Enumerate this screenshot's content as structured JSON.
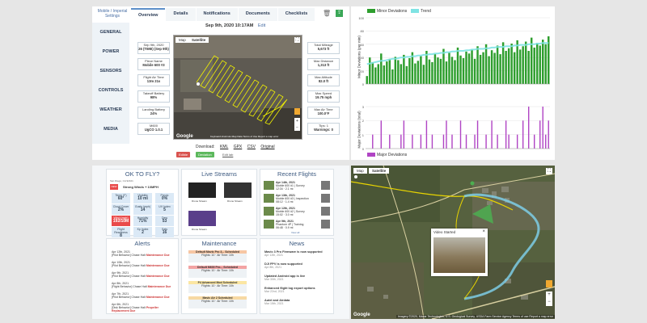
{
  "details": {
    "breadcrumb": "Mobile / Imperial Settings",
    "tabs": [
      "Overview",
      "Details",
      "Notifications",
      "Documents",
      "Checklists"
    ],
    "side_nav": [
      "GENERAL",
      "POWER",
      "SENSORS",
      "CONTROLS",
      "WEATHER",
      "MEDIA"
    ],
    "date_header": "Sep 9th, 2020 10:17AM",
    "edit_label": "Edit",
    "info_left": [
      {
        "label": "Sep 9th, 2020",
        "value": "26 (TIME) (Sep 9th)"
      },
      {
        "label": "Piece Name",
        "value": "Mobile 600 #3"
      },
      {
        "label": "Flight Air Time",
        "value": "13m 21s"
      },
      {
        "label": "Takeoff Battery",
        "value": "98%"
      },
      {
        "label": "Landing Battery",
        "value": "24%"
      },
      {
        "label": "M600",
        "value": "UgCO 1.0.1"
      }
    ],
    "info_right": [
      {
        "label": "Total Mileage",
        "value": "5,673 ft"
      },
      {
        "label": "Max Distance",
        "value": "1,313 ft"
      },
      {
        "label": "Max Altitude",
        "value": "82.0 ft"
      },
      {
        "label": "Max Speed",
        "value": "19.75 mph"
      },
      {
        "label": "Max Air Time",
        "value": "100.0°F"
      },
      {
        "label": "Tips: 1",
        "value": "Warnings: 0"
      }
    ],
    "map_tabs": [
      "Map",
      "Satellite"
    ],
    "map_footer": "Keyboard shortcuts   Map Data   Terms of Use   Report a map error",
    "download_label": "Download:",
    "download_links": [
      "KML",
      "GPX",
      "CSV",
      "Original"
    ],
    "badges": [
      {
        "label": "Edible",
        "color": "#d9534f"
      },
      {
        "label": "Deviation",
        "color": "#5cb85c"
      }
    ],
    "delete_label": "Edit lab"
  },
  "charts": {
    "legend_top": [
      {
        "label": "Minor Deviations",
        "color": "#2e9e2e"
      },
      {
        "label": "Trend",
        "color": "#7fe3e3"
      }
    ],
    "legend_bottom": [
      {
        "label": "Major Deviations",
        "color": "#b044c4"
      }
    ],
    "ylabel_top": "Minor Deviations (per min)",
    "ylabel_bottom": "Major Deviations (total)",
    "yticks_top": [
      "100",
      "80",
      "60",
      "40",
      "20",
      "0"
    ],
    "yticks_bottom": [
      "3",
      "2",
      "1",
      "0"
    ]
  },
  "chart_data": [
    {
      "type": "bar",
      "title": "",
      "ylabel": "Minor Deviations (per min)",
      "ylim": [
        0,
        100
      ],
      "series": [
        {
          "name": "Minor Deviations",
          "values": [
            12,
            40,
            33,
            25,
            30,
            46,
            28,
            34,
            38,
            22,
            41,
            36,
            30,
            44,
            27,
            39,
            48,
            31,
            35,
            42,
            29,
            50,
            37,
            33,
            45,
            40,
            38,
            53,
            34,
            47,
            41,
            36,
            55,
            43,
            39,
            49,
            46,
            52,
            38,
            57,
            44,
            48,
            60,
            42,
            51,
            47,
            58,
            45,
            63,
            50,
            54,
            61,
            48,
            66,
            52,
            57,
            64,
            50,
            70,
            55,
            62,
            58,
            67,
            60,
            72
          ]
        },
        {
          "name": "Trend",
          "values": [
            30,
            31,
            32,
            33,
            34,
            35,
            35,
            36,
            37,
            38,
            38,
            39,
            40,
            40,
            41,
            41,
            42,
            42,
            43,
            43,
            44,
            44,
            45,
            45,
            46,
            46,
            47,
            47,
            48,
            48,
            49,
            49,
            50,
            50,
            50,
            51,
            51,
            52,
            52,
            53,
            53,
            53,
            54,
            54,
            55,
            55,
            56,
            56,
            56,
            57,
            57,
            57,
            58,
            58,
            59,
            59,
            59,
            60,
            60,
            60,
            61,
            61,
            62,
            62,
            62
          ]
        }
      ]
    },
    {
      "type": "bar",
      "title": "",
      "ylabel": "Major Deviations (total)",
      "ylim": [
        0,
        3
      ],
      "series": [
        {
          "name": "Major Deviations",
          "values": [
            0,
            0,
            1,
            0,
            0,
            2,
            0,
            0,
            1,
            0,
            0,
            0,
            1,
            2,
            0,
            0,
            1,
            0,
            0,
            1,
            0,
            2,
            0,
            1,
            0,
            0,
            0,
            1,
            2,
            0,
            1,
            0,
            0,
            2,
            0,
            1,
            0,
            0,
            1,
            2,
            0,
            0,
            1,
            0,
            2,
            0,
            1,
            0,
            0,
            2,
            1,
            0,
            0,
            1,
            0,
            2,
            0,
            3,
            0,
            1,
            0,
            2,
            3,
            1,
            2
          ]
        }
      ]
    }
  ],
  "dashboard": {
    "weather": {
      "title": "OK TO FLY?",
      "location": "San Diego, CA 92101",
      "summary": "Strong Winds + 10MPH",
      "status_badge": "NEW",
      "cells": [
        {
          "label": "Temp (F)",
          "value": "60°"
        },
        {
          "label": "Visibility",
          "value": "10 mi"
        },
        {
          "label": "Precip",
          "value": "0%"
        },
        {
          "label": "Cloud Cover",
          "value": "2%"
        },
        {
          "label": "Gusts (mph)",
          "value": "14"
        },
        {
          "label": "UV Index",
          "value": "5"
        },
        {
          "label": "Wind (mph)",
          "value": "192/10M"
        },
        {
          "label": "Humidity",
          "value": "71%"
        },
        {
          "label": "Dew",
          "value": "53"
        },
        {
          "label": "Flight Readiness",
          "value": "8"
        },
        {
          "label": "Kp Index",
          "value": "2"
        },
        {
          "label": "Sats",
          "value": "16"
        }
      ]
    },
    "streams": {
      "title": "Live Streams",
      "items": [
        "Drone Stream",
        "Drone Stream",
        "Drone Stream"
      ]
    },
    "recent": {
      "title": "Recent Flights",
      "items": [
        {
          "date": "Apr 14th, 2021",
          "desc": "Mobile 600 #1 | Survey",
          "meta": "12:34 · 2.1 mi"
        },
        {
          "date": "Apr 13th, 2021",
          "desc": "Mobile 600 #3 | Inspection",
          "meta": "08:12 · 1.4 mi"
        },
        {
          "date": "Apr 12th, 2021",
          "desc": "Mobile 600 #2 | Survey",
          "meta": "15:02 · 3.0 mi"
        },
        {
          "date": "Apr 9th, 2021",
          "desc": "Phantom 4P | Training",
          "meta": "06:48 · 0.9 mi"
        }
      ],
      "more": "View all"
    },
    "alerts": {
      "title": "Alerts",
      "items": [
        {
          "date": "Apr 12th, 2021",
          "text": "[Pilot Behavior] Chase Halt",
          "status": "Maintenance Due"
        },
        {
          "date": "Apr 10th, 2021",
          "text": "[Pilot Behavior] Chase Halt",
          "status": "Maintenance Due"
        },
        {
          "date": "Apr 9th, 2021",
          "text": "[Pilot Behavior] Chase Halt",
          "status": "Maintenance Due"
        },
        {
          "date": "Apr 8th, 2021",
          "text": "[Flight Behavior] Chase Halt",
          "status": "Maintenance Due"
        },
        {
          "date": "Apr 7th, 2021",
          "text": "[Pilot Behavior] Chase Halt",
          "status": "Maintenance Due"
        },
        {
          "date": "Apr 6th, 2021",
          "text": "[Disk Behavior] Chase Halt",
          "status": "Propeller Replacement Due"
        }
      ]
    },
    "maintenance": {
      "title": "Maintenance",
      "items": [
        {
          "head": "Default Mavic Pro 3... Scheduled",
          "flights": "Flights: 10",
          "time": "Air Time: 10h"
        },
        {
          "head": "Default M600 Pro... Scheduled",
          "flights": "Flights: 10",
          "time": "Air Time: 10h"
        },
        {
          "head": "P4 Advanced Mod Scheduled",
          "flights": "Flights: 10",
          "time": "Air Time: 10h"
        },
        {
          "head": "Mavic Air 2 Scheduled",
          "flights": "Flights: 10",
          "time": "Air Time: 10h"
        }
      ]
    },
    "news": {
      "title": "News",
      "items": [
        {
          "title": "Mavic 3 Pro Firmware is now supported",
          "date": "Apr 12th, 2021"
        },
        {
          "title": "DJI FPV is now supported",
          "date": "Apr 8th, 2021"
        },
        {
          "title": "Updated Android app is live",
          "date": "Mar 30th, 2021"
        },
        {
          "title": "Enhanced flight log export options",
          "date": "Mar 22nd, 2021"
        },
        {
          "title": "Autel and Airdata",
          "date": "Mar 15th, 2021"
        }
      ]
    }
  },
  "map": {
    "tabs": [
      "Map",
      "Satellite"
    ],
    "popup_title": "Video Started",
    "google_logo": "Google",
    "attribution": "Imagery ©2020, Maxar Technologies, U.S. Geological Survey, USDA Farm Service Agency   Terms of use   Report a map error"
  }
}
